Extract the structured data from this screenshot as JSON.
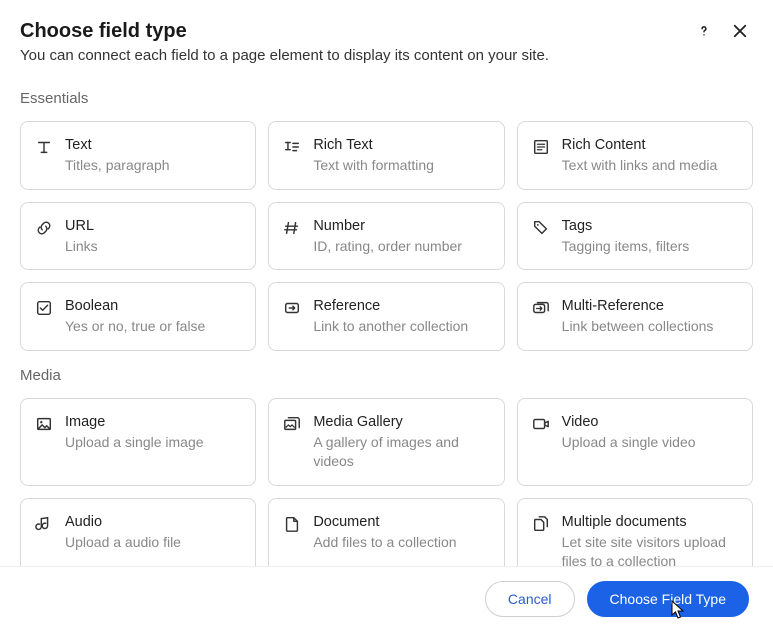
{
  "header": {
    "title": "Choose field type",
    "subtitle": "You can connect each field to a page element to display its content on your site."
  },
  "sections": [
    {
      "label": "Essentials",
      "items": [
        {
          "icon": "text",
          "title": "Text",
          "desc": "Titles, paragraph"
        },
        {
          "icon": "rich-text",
          "title": "Rich Text",
          "desc": "Text with formatting"
        },
        {
          "icon": "rich-content",
          "title": "Rich Content",
          "desc": "Text with links and media"
        },
        {
          "icon": "url",
          "title": "URL",
          "desc": "Links"
        },
        {
          "icon": "number",
          "title": "Number",
          "desc": "ID, rating, order number"
        },
        {
          "icon": "tags",
          "title": "Tags",
          "desc": "Tagging items, filters"
        },
        {
          "icon": "boolean",
          "title": "Boolean",
          "desc": "Yes or no, true or false"
        },
        {
          "icon": "reference",
          "title": "Reference",
          "desc": "Link to another collection"
        },
        {
          "icon": "multi-reference",
          "title": "Multi-Reference",
          "desc": "Link between collections"
        }
      ]
    },
    {
      "label": "Media",
      "items": [
        {
          "icon": "image",
          "title": "Image",
          "desc": "Upload a single image"
        },
        {
          "icon": "media-gallery",
          "title": "Media Gallery",
          "desc": "A gallery of images and videos"
        },
        {
          "icon": "video",
          "title": "Video",
          "desc": "Upload a single video"
        },
        {
          "icon": "audio",
          "title": "Audio",
          "desc": "Upload a audio file"
        },
        {
          "icon": "document",
          "title": "Document",
          "desc": "Add files to a collection"
        },
        {
          "icon": "multiple-documents",
          "title": "Multiple documents",
          "desc": "Let site site visitors upload files to a collection"
        }
      ]
    }
  ],
  "footer": {
    "cancel": "Cancel",
    "submit": "Choose Field Type"
  }
}
